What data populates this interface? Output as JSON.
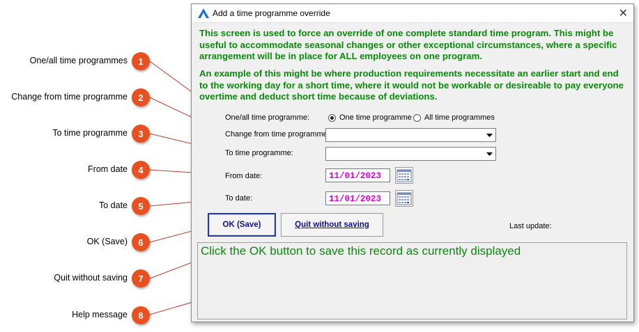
{
  "callouts": [
    {
      "number": "1",
      "label": "One/all time programmes"
    },
    {
      "number": "2",
      "label": "Change from time programme"
    },
    {
      "number": "3",
      "label": "To time programme"
    },
    {
      "number": "4",
      "label": "From date"
    },
    {
      "number": "5",
      "label": "To date"
    },
    {
      "number": "6",
      "label": "OK (Save)"
    },
    {
      "number": "7",
      "label": "Quit without saving"
    },
    {
      "number": "8",
      "label": "Help message"
    }
  ],
  "window": {
    "title": "Add a time programme override",
    "close_glyph": "✕"
  },
  "intro": {
    "para1": "This screen is used to force an override of one complete standard time program. This might be useful to accommodate seasonal changes or other exceptional circumstances, where a specific arrangement will be in place for ALL employees on one program.",
    "para2": "An example of this might be where production requirements necessitate an earlier start and end to the working day for a short time, where it would not be workable or desireable to pay everyone overtime and deduct short time because of deviations."
  },
  "form": {
    "one_all_label": "One/all time programme:",
    "radio_one": "One time programme",
    "radio_all": "All time programmes",
    "radio_selected": "one",
    "change_from_label": "Change from time programme:",
    "change_from_value": "",
    "to_prog_label": "To time programme:",
    "to_prog_value": "",
    "from_date_label": "From date:",
    "from_date_value": "11/01/2023",
    "to_date_label": "To date:",
    "to_date_value": "11/01/2023"
  },
  "buttons": {
    "ok": "OK (Save)",
    "quit": "Quit without saving"
  },
  "last_update_label": "Last update:",
  "help_message": "Click the OK button to save this record as currently displayed",
  "colors": {
    "badge": "#e8501f",
    "intro_text": "#0a8a0a",
    "date_text": "#e000e0",
    "button_text": "#10108a"
  }
}
